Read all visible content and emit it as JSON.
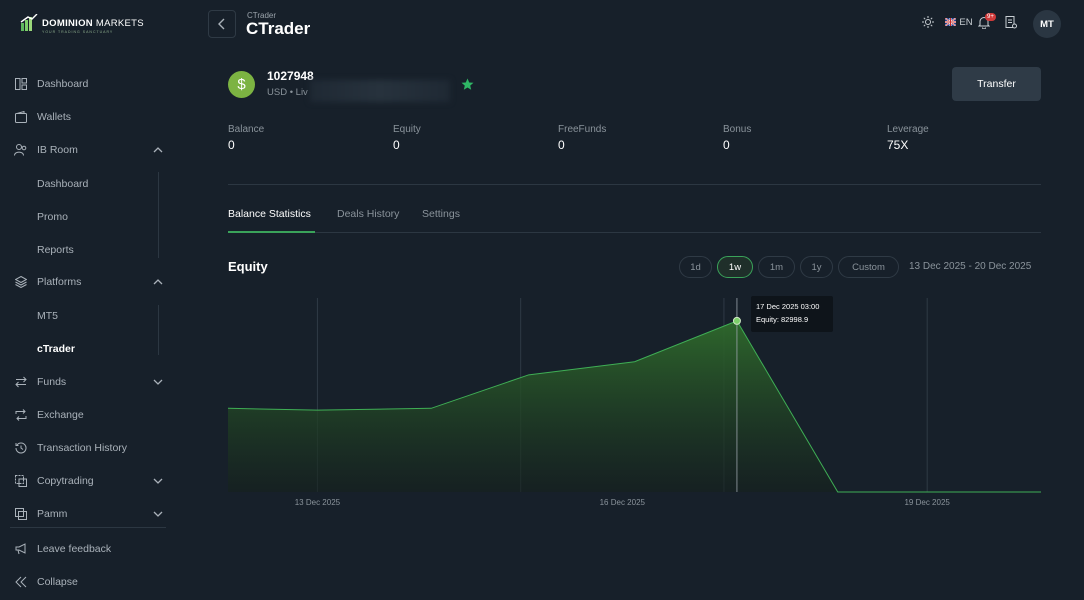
{
  "brand": {
    "name_bold": "DOMINION",
    "name_rest": " MARKETS",
    "tagline": "YOUR TRADING SANCTUARY"
  },
  "sidebar": {
    "items": [
      {
        "label": "Dashboard",
        "icon": "dashboard-icon"
      },
      {
        "label": "Wallets",
        "icon": "wallet-icon"
      },
      {
        "label": "IB Room",
        "icon": "users-icon",
        "expanded": true
      },
      {
        "label": "Platforms",
        "icon": "layers-icon",
        "expanded": true
      },
      {
        "label": "Funds",
        "icon": "transfer-icon",
        "expanded": false
      },
      {
        "label": "Exchange",
        "icon": "exchange-icon"
      },
      {
        "label": "Transaction History",
        "icon": "history-icon"
      },
      {
        "label": "Copytrading",
        "icon": "copytrading-icon",
        "expanded": false
      },
      {
        "label": "Pamm",
        "icon": "pamm-icon",
        "expanded": false
      }
    ],
    "ib_sub": [
      "Dashboard",
      "Promo",
      "Reports"
    ],
    "platform_sub": [
      "MT5",
      "cTrader"
    ],
    "feedback": "Leave feedback",
    "collapse": "Collapse"
  },
  "header": {
    "breadcrumb": "CTrader",
    "title": "CTrader",
    "language": "EN",
    "notifications": "9+",
    "avatar": "MT"
  },
  "account": {
    "number": "1027948",
    "subtitle": "USD • Liv",
    "currency_symbol": "$",
    "transfer_label": "Transfer"
  },
  "stats": [
    {
      "label": "Balance",
      "value": "0"
    },
    {
      "label": "Equity",
      "value": "0"
    },
    {
      "label": "FreeFunds",
      "value": "0"
    },
    {
      "label": "Bonus",
      "value": "0"
    },
    {
      "label": "Leverage",
      "value": "75X"
    }
  ],
  "tabs": [
    "Balance Statistics",
    "Deals History",
    "Settings"
  ],
  "equity": {
    "title": "Equity",
    "periods": [
      "1d",
      "1w",
      "1m",
      "1y",
      "Custom"
    ],
    "active_period": "1w",
    "range": "13 Dec 2025 - 20 Dec 2025",
    "tooltip_time": "17 Dec 2025 03:00",
    "tooltip_value": "Equity: 82998.9"
  },
  "chart_data": {
    "type": "area",
    "xlabel": "",
    "ylabel": "",
    "x_ticks": [
      "13 Dec 2025",
      "16 Dec 2025",
      "19 Dec 2025"
    ],
    "series": [
      {
        "values": [
          0.45,
          0.44,
          0.45,
          0.63,
          0.7,
          0.92,
          0.0,
          0.0,
          0.0
        ]
      }
    ],
    "x": [
      0,
      0.11,
      0.25,
      0.37,
      0.5,
      0.626,
      0.75,
      0.9,
      1.0
    ],
    "highlight_index": 5,
    "colors": {
      "line": "#3fae55",
      "fill_top": "#2f6b2c",
      "fill_bottom": "#15211d"
    }
  }
}
